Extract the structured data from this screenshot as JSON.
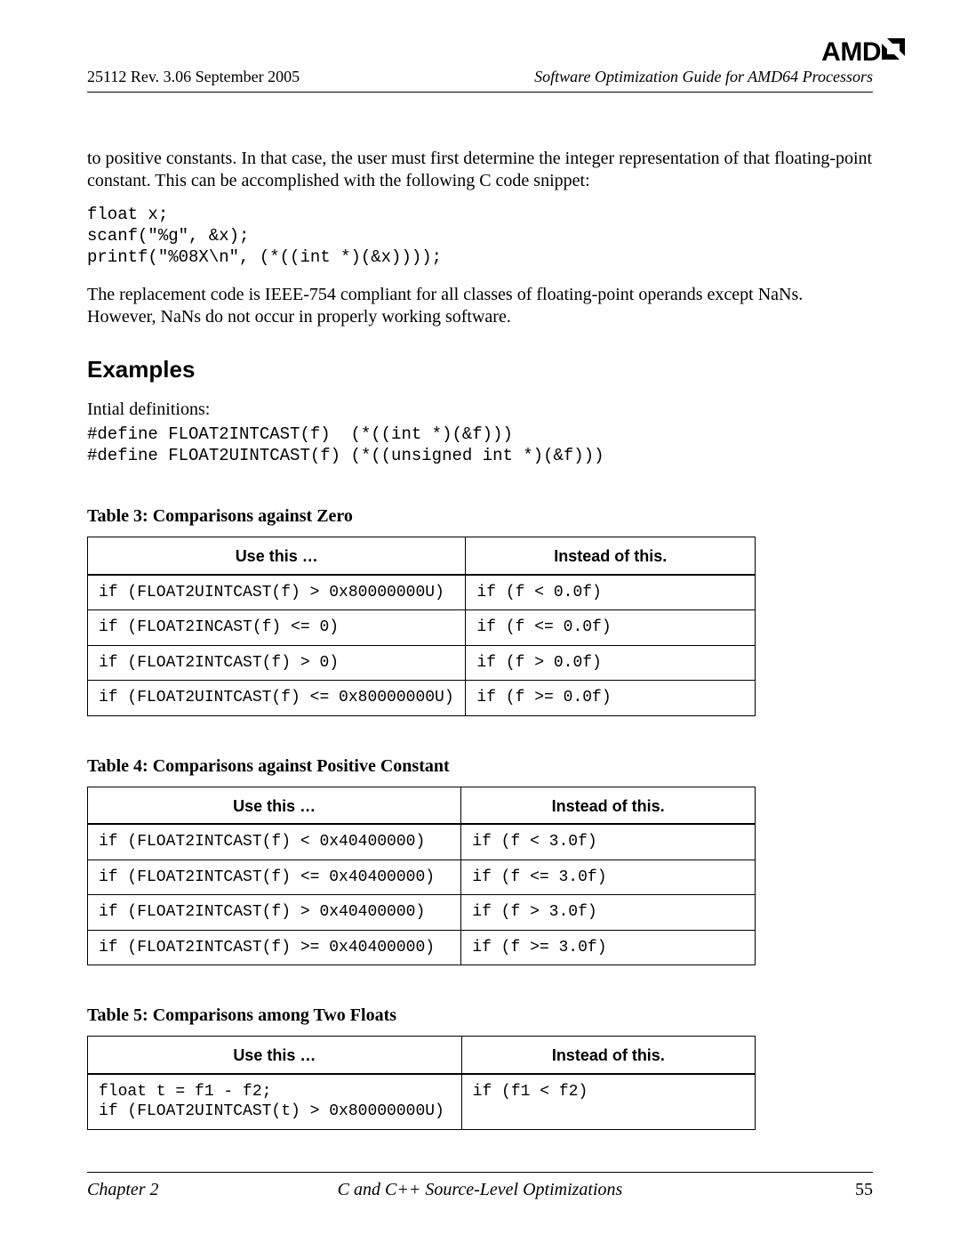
{
  "header": {
    "logo_text": "AMD",
    "rev_line": "25112   Rev. 3.06   September 2005",
    "doc_title": "Software Optimization Guide for AMD64 Processors"
  },
  "body": {
    "para1": "to positive constants. In that case, the user must first determine the integer representation of that floating-point constant. This can be accomplished with the following C code snippet:",
    "code1": "float x;\nscanf(\"%g\", &x);\nprintf(\"%08X\\n\", (*((int *)(&x))));",
    "para2": "The replacement code is IEEE-754 compliant for all classes of floating-point operands except NaNs. However, NaNs do not occur in properly working software.",
    "examples_heading": "Examples",
    "defs_label": "Intial definitions:",
    "defs_code": "#define FLOAT2INTCAST(f)  (*((int *)(&f)))\n#define FLOAT2UINTCAST(f) (*((unsigned int *)(&f)))"
  },
  "tables": {
    "col_use": "Use this …",
    "col_instead": "Instead of this.",
    "t3": {
      "caption": "Table 3: Comparisons against Zero",
      "rows": [
        {
          "use": "if (FLOAT2UINTCAST(f) > 0x80000000U)",
          "instead": "if (f < 0.0f)"
        },
        {
          "use": "if (FLOAT2INCAST(f) <= 0)",
          "instead": "if (f <= 0.0f)"
        },
        {
          "use": "if (FLOAT2INTCAST(f) > 0)",
          "instead": "if (f > 0.0f)"
        },
        {
          "use": "if (FLOAT2UINTCAST(f) <= 0x80000000U)",
          "instead": "if (f >= 0.0f)"
        }
      ]
    },
    "t4": {
      "caption": "Table 4: Comparisons against Positive Constant",
      "rows": [
        {
          "use": "if (FLOAT2INTCAST(f) < 0x40400000)",
          "instead": "if (f < 3.0f)"
        },
        {
          "use": "if (FLOAT2INTCAST(f) <= 0x40400000)",
          "instead": "if (f <= 3.0f)"
        },
        {
          "use": "if (FLOAT2INTCAST(f) > 0x40400000)",
          "instead": "if (f > 3.0f)"
        },
        {
          "use": "if (FLOAT2INTCAST(f) >= 0x40400000)",
          "instead": "if (f >= 3.0f)"
        }
      ]
    },
    "t5": {
      "caption": "Table 5: Comparisons among Two Floats",
      "rows": [
        {
          "use": "float t = f1 - f2;\nif (FLOAT2UINTCAST(t) > 0x80000000U)",
          "instead": "if (f1 < f2)"
        }
      ]
    }
  },
  "footer": {
    "chapter": "Chapter 2",
    "title": "C and C++ Source-Level Optimizations",
    "page": "55"
  }
}
